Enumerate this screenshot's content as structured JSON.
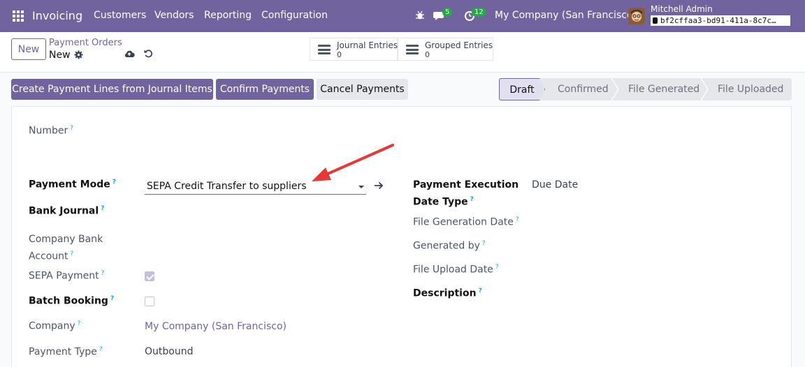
{
  "navbar": {
    "brand": "Invoicing",
    "menu": [
      "Customers",
      "Vendors",
      "Reporting",
      "Configuration"
    ],
    "messages_badge": "5",
    "activities_badge": "12",
    "company": "My Company (San Francisco)",
    "user_name": "Mitchell Admin",
    "db_name": "bf2cffaa3-bd91-411a-8c7c…"
  },
  "control": {
    "new_label": "New",
    "breadcrumb_parent": "Payment Orders",
    "breadcrumb_current": "New",
    "smart_buttons": [
      {
        "label": "Journal Entries",
        "count": "0"
      },
      {
        "label": "Grouped Entries",
        "count": "0"
      }
    ]
  },
  "actions": {
    "create_lines": "Create Payment Lines from Journal Items",
    "confirm": "Confirm Payments",
    "cancel": "Cancel Payments"
  },
  "status": {
    "stages": [
      "Draft",
      "Confirmed",
      "File Generated",
      "File Uploaded"
    ],
    "active": "Draft"
  },
  "form": {
    "number_label": "Number",
    "payment_mode_label": "Payment Mode",
    "payment_mode_value": "SEPA Credit Transfer to suppliers",
    "bank_journal_label": "Bank Journal",
    "company_bank_account_label_1": "Company Bank",
    "company_bank_account_label_2": "Account",
    "sepa_payment_label": "SEPA Payment",
    "batch_booking_label": "Batch Booking",
    "company_label": "Company",
    "company_value": "My Company (San Francisco)",
    "payment_type_label": "Payment Type",
    "payment_type_value": "Outbound",
    "exec_date_type_label_1": "Payment Execution",
    "exec_date_type_label_2": "Date Type",
    "exec_date_type_value": "Due Date",
    "file_generation_date_label": "File Generation Date",
    "generated_by_label": "Generated by",
    "file_upload_date_label": "File Upload Date",
    "description_label": "Description",
    "help_mark": "?"
  },
  "colors": {
    "brand": "#71639e",
    "annotation_arrow": "#e53935",
    "badge": "#28a745"
  }
}
